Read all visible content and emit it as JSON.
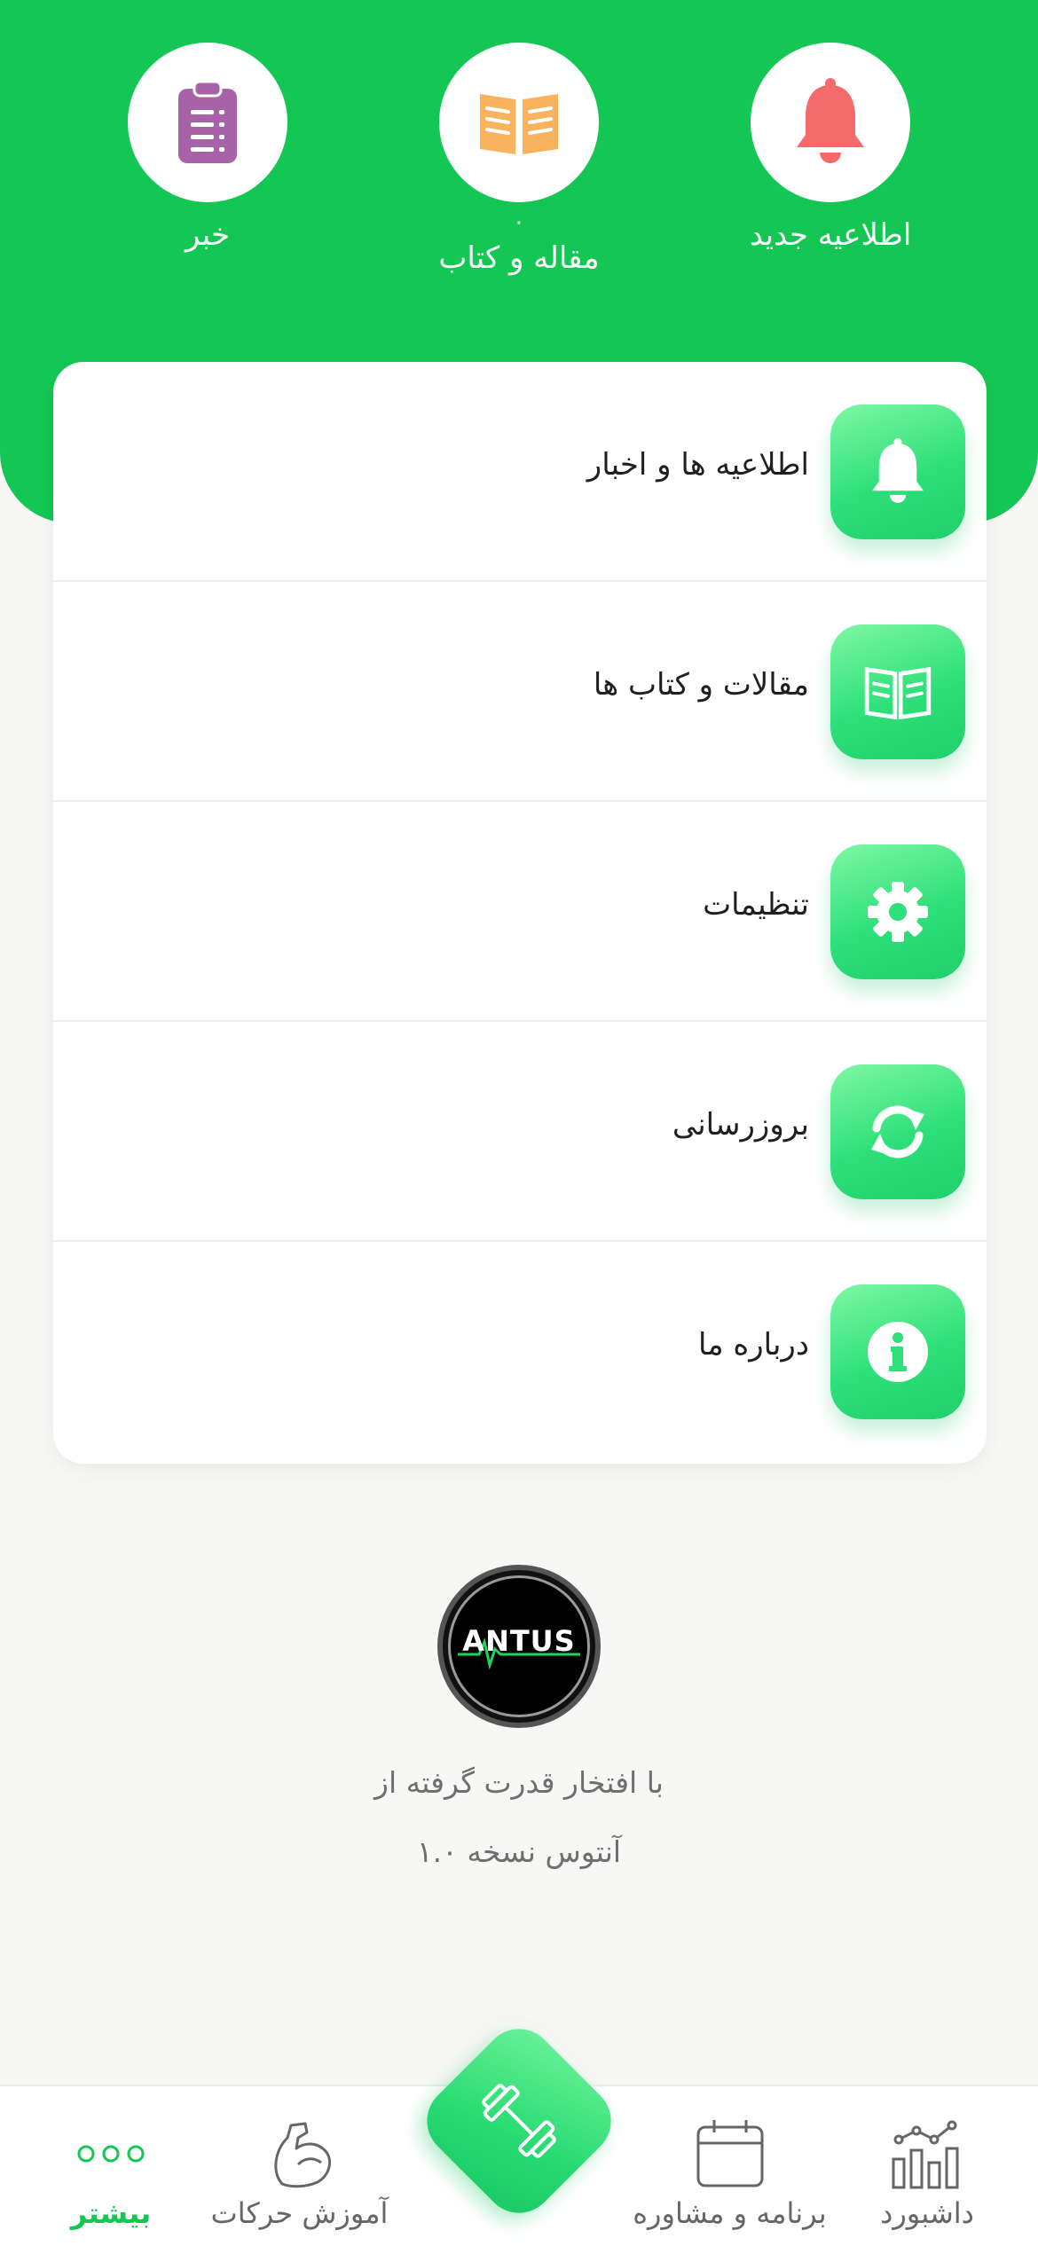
{
  "colors": {
    "brand_green": "#14c754",
    "bell_red": "#f56a6a",
    "book_orange": "#f9b35c",
    "news_purple": "#a862a8"
  },
  "header": {
    "shortcuts": [
      {
        "label": "اطلاعیه جدید",
        "icon": "bell-icon"
      },
      {
        "label": "مقاله و کتاب",
        "count": "۰",
        "icon": "book-icon"
      },
      {
        "label": "خبر",
        "icon": "clipboard-icon"
      }
    ]
  },
  "menu": {
    "items": [
      {
        "label": "اطلاعیه ها و اخبار",
        "icon": "bell-icon"
      },
      {
        "label": "مقالات و کتاب ها",
        "icon": "book-icon"
      },
      {
        "label": "تنظیمات",
        "icon": "gear-icon"
      },
      {
        "label": "بروزرسانی",
        "icon": "refresh-icon"
      },
      {
        "label": "درباره ما",
        "icon": "info-icon"
      }
    ]
  },
  "footer": {
    "logo_text": "ANTUS",
    "powered_by": "با افتخار قدرت گرفته از",
    "version": "آنتوس نسخه ۱.۰"
  },
  "bottom_nav": {
    "items": [
      {
        "label": "داشبورد",
        "icon": "dashboard-chart-icon"
      },
      {
        "label": "برنامه و مشاوره",
        "icon": "calendar-icon"
      },
      {
        "label": "آموزش حرکات",
        "icon": "muscle-arm-icon"
      },
      {
        "label": "بیشتر",
        "icon": "more-dots-icon",
        "active": true
      }
    ],
    "center_action_icon": "dumbbell-icon"
  }
}
